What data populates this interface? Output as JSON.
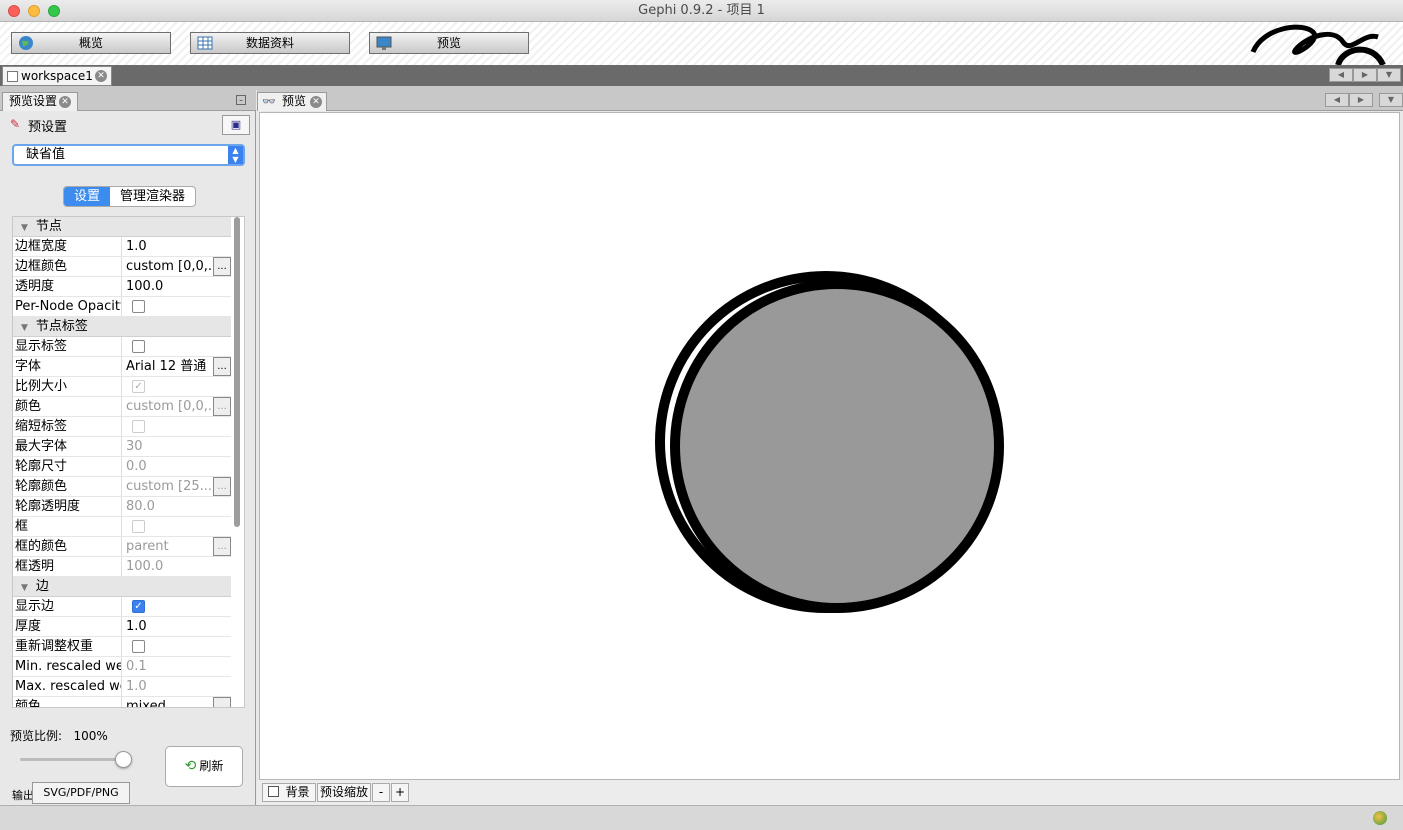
{
  "window": {
    "title": "Gephi 0.9.2 - 项目 1"
  },
  "toolbar": {
    "buttons": [
      {
        "label": "概览",
        "icon": "globe-icon"
      },
      {
        "label": "数据资料",
        "icon": "table-icon"
      },
      {
        "label": "预览",
        "icon": "monitor-icon"
      }
    ]
  },
  "workspace": {
    "tab_label": "workspace1"
  },
  "left_panel": {
    "tab_label": "预览设置",
    "preset_label": "预设置",
    "preset_value": "缺省值",
    "seg_tabs": [
      "设置",
      "管理渲染器"
    ],
    "scale_label": "预览比例:",
    "scale_value": "100%",
    "scale_fraction": 1.0,
    "refresh_label": "刷新",
    "export_label": "输出",
    "export_button": "SVG/PDF/PNG"
  },
  "properties": {
    "rows": [
      {
        "type": "cat",
        "key": "节点"
      },
      {
        "type": "text",
        "key": "边框宽度",
        "value": "1.0"
      },
      {
        "type": "text",
        "key": "边框颜色",
        "value": "custom [0,0,...",
        "button": true
      },
      {
        "type": "text",
        "key": "透明度",
        "value": "100.0"
      },
      {
        "type": "check",
        "key": "Per-Node Opacity",
        "checked": false
      },
      {
        "type": "cat",
        "key": "节点标签"
      },
      {
        "type": "check",
        "key": "显示标签",
        "checked": false
      },
      {
        "type": "text",
        "key": "字体",
        "value": "Arial 12 普通",
        "button": true
      },
      {
        "type": "check",
        "key": "比例大小",
        "checked": true,
        "disabled": true
      },
      {
        "type": "text",
        "key": "颜色",
        "value": "custom [0,0,...",
        "button": true,
        "disabled": true
      },
      {
        "type": "check",
        "key": "缩短标签",
        "checked": false,
        "disabled": true
      },
      {
        "type": "text",
        "key": "最大字体",
        "value": "30",
        "disabled": true
      },
      {
        "type": "text",
        "key": "轮廓尺寸",
        "value": "0.0",
        "disabled": true
      },
      {
        "type": "text",
        "key": "轮廓颜色",
        "value": "custom [25...",
        "button": true,
        "disabled": true
      },
      {
        "type": "text",
        "key": "轮廓透明度",
        "value": "80.0",
        "disabled": true
      },
      {
        "type": "check",
        "key": "框",
        "checked": false,
        "disabled": true
      },
      {
        "type": "text",
        "key": "框的颜色",
        "value": "parent",
        "button": true,
        "disabled": true
      },
      {
        "type": "text",
        "key": "框透明",
        "value": "100.0",
        "disabled": true
      },
      {
        "type": "cat",
        "key": "边"
      },
      {
        "type": "check",
        "key": "显示边",
        "checked": true
      },
      {
        "type": "text",
        "key": "厚度",
        "value": "1.0"
      },
      {
        "type": "check",
        "key": "重新调整权重",
        "checked": false
      },
      {
        "type": "text",
        "key": "Min. rescaled weight",
        "value": "0.1",
        "disabled": true
      },
      {
        "type": "text",
        "key": "Max. rescaled weight",
        "value": "1.0",
        "disabled": true
      },
      {
        "type": "text",
        "key": "颜色",
        "value": "mixed",
        "button": true
      }
    ]
  },
  "preview": {
    "tab_label": "预览",
    "node_fill": "#999999",
    "node_stroke": "#000000",
    "bottom": {
      "background_label": "背景",
      "reset_zoom_label": "预设缩放",
      "zoom_out": "-",
      "zoom_in": "+"
    }
  }
}
